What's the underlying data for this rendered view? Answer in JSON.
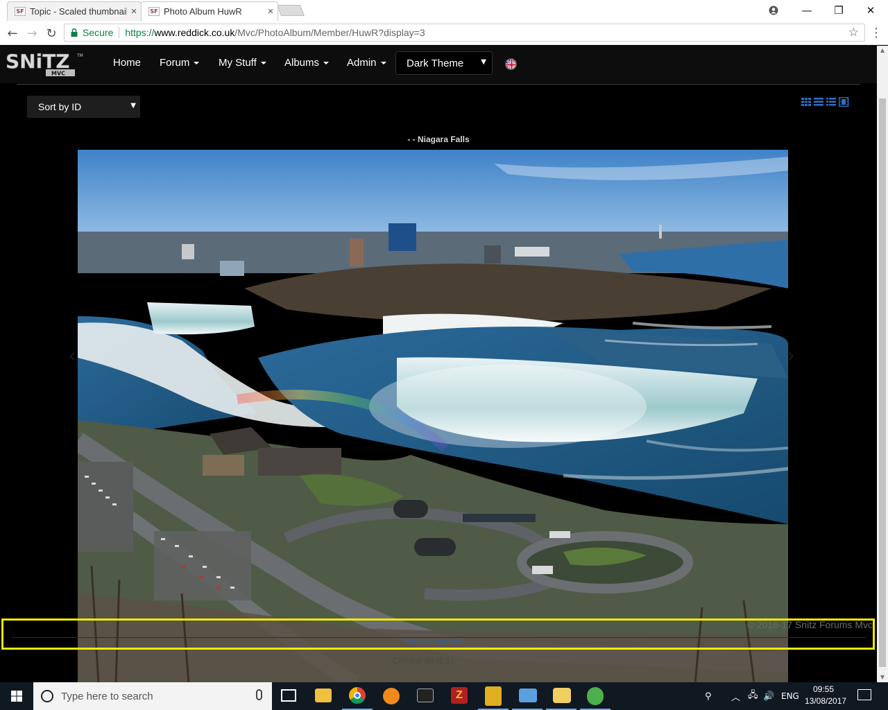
{
  "browser": {
    "tabs": [
      {
        "title": "Topic - Scaled thumbnail",
        "favicon": "SF",
        "active": false
      },
      {
        "title": "Photo Album HuwR",
        "favicon": "SF",
        "active": true
      }
    ],
    "window_controls": {
      "minimize": "—",
      "restore": "❐",
      "close": "✕"
    },
    "nav": {
      "back": "←",
      "forward": "→",
      "reload": "↻"
    },
    "omnibox": {
      "secure_label": "Secure",
      "scheme": "https://",
      "host": "www.reddick.co.uk",
      "path": "/Mvc/PhotoAlbum/Member/HuwR?display=3"
    },
    "bookmark_icon": "☆",
    "menu_icon": "⋮"
  },
  "site": {
    "logo": {
      "text": "SNiTZ",
      "sub": "MVC",
      "tm": "TM"
    },
    "nav": [
      {
        "label": "Home",
        "dropdown": false
      },
      {
        "label": "Forum",
        "dropdown": true
      },
      {
        "label": "My Stuff",
        "dropdown": true
      },
      {
        "label": "Albums",
        "dropdown": true
      },
      {
        "label": "Admin",
        "dropdown": true
      }
    ],
    "theme_select": {
      "selected": "Dark Theme"
    },
    "language_flag": "uk-flag-icon"
  },
  "album": {
    "sort_select": {
      "selected": "Sort by ID"
    },
    "view_modes": [
      "grid-view-icon",
      "list-view-icon",
      "detail-list-icon",
      "filmstrip-icon"
    ],
    "caption": "- - Niagara Falls",
    "carousel": {
      "prev": "‹",
      "next": "›"
    }
  },
  "footer": {
    "copyright": "© 2016-17 Snitz Forums Mvc",
    "link_text": "Snitz Forums Mvc",
    "browser_info": "Chrome 60 (1.1)"
  },
  "taskbar": {
    "search_placeholder": "Type here to search",
    "language": "ENG",
    "time": "09:55",
    "date": "13/08/2017"
  },
  "colors": {
    "accent_link": "#3a5e8c",
    "highlight": "#f2ea00",
    "secure_green": "#0b8043",
    "view_icon_blue": "#2f6fc4"
  }
}
